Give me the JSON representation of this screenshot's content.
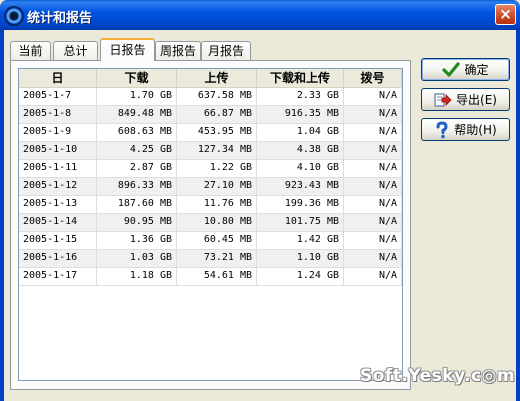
{
  "window": {
    "title": "统计和报告",
    "close_glyph": "×"
  },
  "tabs": [
    {
      "label": "当前",
      "active": false
    },
    {
      "label": "总计",
      "active": false
    },
    {
      "label": "日报告",
      "active": true
    },
    {
      "label": "周报告",
      "active": false
    },
    {
      "label": "月报告",
      "active": false
    }
  ],
  "table": {
    "headers": [
      "日",
      "下载",
      "上传",
      "下载和上传",
      "拨号"
    ],
    "rows": [
      [
        "2005-1-7",
        "1.70 GB",
        "637.58 MB",
        "2.33 GB",
        "N/A"
      ],
      [
        "2005-1-8",
        "849.48 MB",
        "66.87 MB",
        "916.35 MB",
        "N/A"
      ],
      [
        "2005-1-9",
        "608.63 MB",
        "453.95 MB",
        "1.04 GB",
        "N/A"
      ],
      [
        "2005-1-10",
        "4.25 GB",
        "127.34 MB",
        "4.38 GB",
        "N/A"
      ],
      [
        "2005-1-11",
        "2.87 GB",
        "1.22 GB",
        "4.10 GB",
        "N/A"
      ],
      [
        "2005-1-12",
        "896.33 MB",
        "27.10 MB",
        "923.43 MB",
        "N/A"
      ],
      [
        "2005-1-13",
        "187.60 MB",
        "11.76 MB",
        "199.36 MB",
        "N/A"
      ],
      [
        "2005-1-14",
        "90.95 MB",
        "10.80 MB",
        "101.75 MB",
        "N/A"
      ],
      [
        "2005-1-15",
        "1.36 GB",
        "60.45 MB",
        "1.42 GB",
        "N/A"
      ],
      [
        "2005-1-16",
        "1.03 GB",
        "73.21 MB",
        "1.10 GB",
        "N/A"
      ],
      [
        "2005-1-17",
        "1.18 GB",
        "54.61 MB",
        "1.24 GB",
        "N/A"
      ]
    ]
  },
  "buttons": {
    "ok": {
      "label": "确定",
      "icon": "check-icon"
    },
    "export": {
      "label": "导出(E)",
      "icon": "export-icon"
    },
    "help": {
      "label": "帮助(H)",
      "icon": "help-icon"
    }
  },
  "watermark": "Soft.Yesky.c◎m",
  "colors": {
    "title_bar": "#0054e3",
    "face": "#ece9d8",
    "active_tab_accent": "#f5ad38"
  }
}
